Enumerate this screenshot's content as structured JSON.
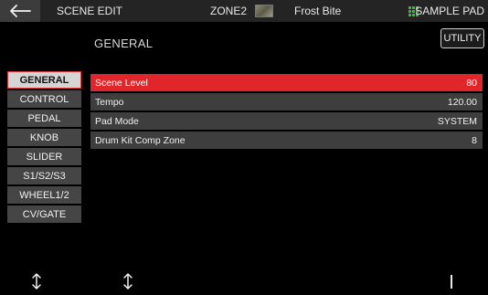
{
  "header": {
    "title": "SCENE EDIT",
    "zone": "ZONE2",
    "scene_name": "Frost Bite",
    "sample_pad": "SAMPLE PAD"
  },
  "page": {
    "heading": "GENERAL",
    "utility_label": "UTILITY"
  },
  "sidebar": {
    "items": [
      {
        "label": "GENERAL"
      },
      {
        "label": "CONTROL"
      },
      {
        "label": "PEDAL"
      },
      {
        "label": "KNOB"
      },
      {
        "label": "SLIDER"
      },
      {
        "label": "S1/S2/S3"
      },
      {
        "label": "WHEEL1/2"
      },
      {
        "label": "CV/GATE"
      }
    ]
  },
  "params": [
    {
      "name": "Scene Level",
      "value": "80"
    },
    {
      "name": "Tempo",
      "value": "120.00"
    },
    {
      "name": "Pad Mode",
      "value": "SYSTEM"
    },
    {
      "name": "Drum Kit Comp Zone",
      "value": "8"
    }
  ],
  "colors": {
    "accent_red": "#e0262b",
    "pad_green": "#2fbf3a"
  },
  "icons": {
    "back": "back-arrow-icon",
    "updown": "up-down-arrow-icon",
    "grid": "grid-icon"
  }
}
